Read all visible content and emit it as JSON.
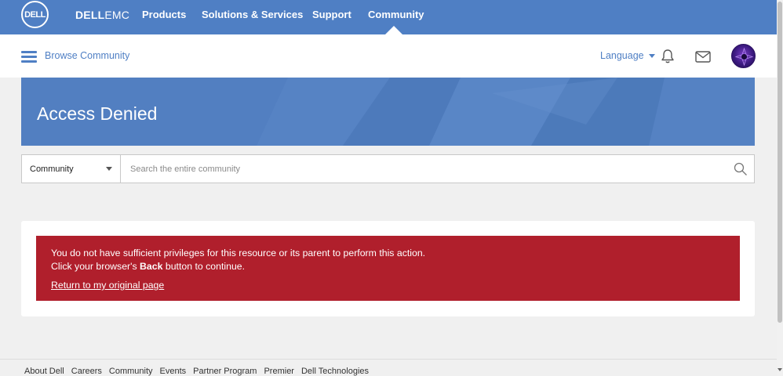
{
  "topnav": {
    "logo_text": "DELL",
    "brand_bold": "DELL",
    "brand_light": "EMC",
    "items": [
      {
        "label": "Products"
      },
      {
        "label": "Solutions & Services"
      },
      {
        "label": "Support"
      },
      {
        "label": "Community"
      }
    ],
    "active_item": "Community",
    "color": "#4f7fc4"
  },
  "subbar": {
    "browse_label": "Browse Community",
    "language_label": "Language",
    "icons": [
      "menu-icon",
      "bell-icon",
      "mail-icon",
      "avatar"
    ]
  },
  "hero": {
    "title": "Access Denied"
  },
  "search": {
    "scope_value": "Community",
    "placeholder": "Search the entire community"
  },
  "alert": {
    "line1": "You do not have sufficient privileges for this resource or its parent to perform this action.",
    "line2_pre": "Click your browser's ",
    "line2_bold": "Back",
    "line2_post": " button to continue.",
    "return_link": "Return to my original page",
    "color": "#b01f2c"
  },
  "footer": {
    "links": [
      "About Dell",
      "Careers",
      "Community",
      "Events",
      "Partner Program",
      "Premier",
      "Dell Technologies"
    ]
  }
}
